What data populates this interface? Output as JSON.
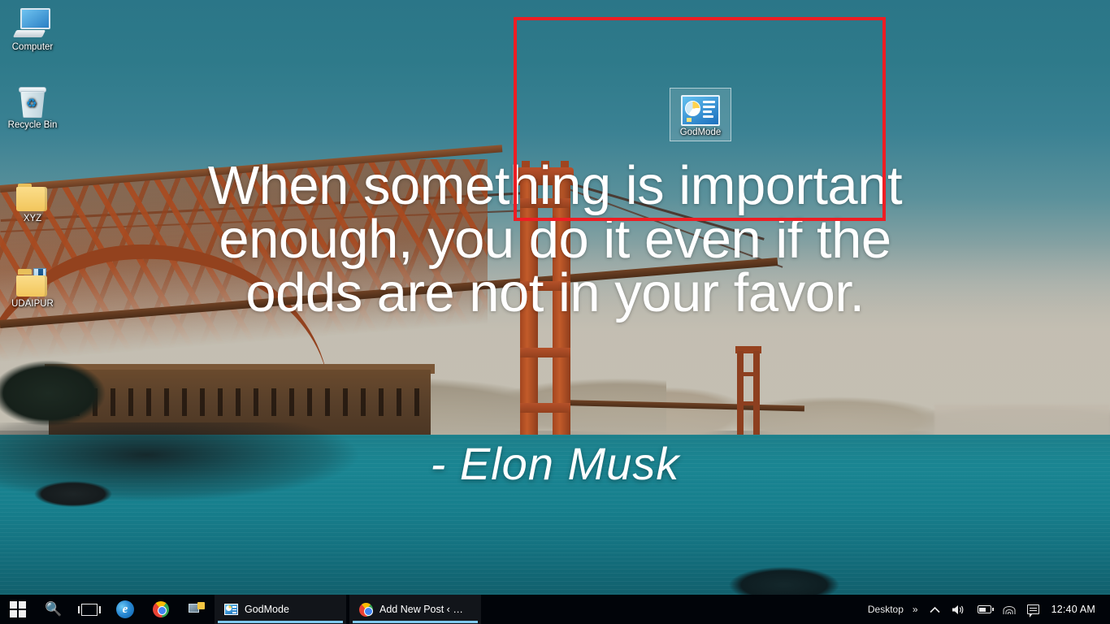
{
  "wallpaper": {
    "description": "Golden Gate Bridge at sunset over teal bay water",
    "sky_color": "#2b7688",
    "water_color": "#1a8592",
    "bridge_color": "#a3451f"
  },
  "quote": {
    "lines": [
      "When something is important",
      "enough, you do it even if the",
      "odds are not in your favor."
    ],
    "attribution": "- Elon Musk"
  },
  "annotation": {
    "shape": "rectangle",
    "color": "#ee1d23"
  },
  "desktop_icons": [
    {
      "label": "Computer",
      "icon": "computer-monitor-icon",
      "selected": false
    },
    {
      "label": "Recycle Bin",
      "icon": "recycle-bin-icon",
      "selected": false
    },
    {
      "label": "XYZ",
      "icon": "folder-icon",
      "selected": false
    },
    {
      "label": "UDAIPUR",
      "icon": "folder-with-file-icon",
      "selected": false
    },
    {
      "label": "GodMode",
      "icon": "control-panel-icon",
      "selected": true
    }
  ],
  "taskbar": {
    "start_label": "Start",
    "search_label": "Search",
    "task_view_label": "Task View",
    "pinned": [
      {
        "label": "Microsoft Edge",
        "icon": "edge-icon"
      },
      {
        "label": "Google Chrome",
        "icon": "chrome-icon"
      },
      {
        "label": "Remote Desktop",
        "icon": "remote-desktop-icon"
      }
    ],
    "windows": [
      {
        "label": "GodMode",
        "icon": "control-panel-icon",
        "active": true
      },
      {
        "label": "Add New Post ‹ — W...",
        "icon": "chrome-icon",
        "active": true
      }
    ],
    "tray": {
      "desktop_label": "Desktop",
      "overflow_label": "»",
      "show_hidden_label": "Show hidden icons",
      "volume_label": "Speakers",
      "battery_label": "Battery",
      "network_label": "Network",
      "notifications_label": "Action Center",
      "time": "12:40 AM"
    }
  }
}
